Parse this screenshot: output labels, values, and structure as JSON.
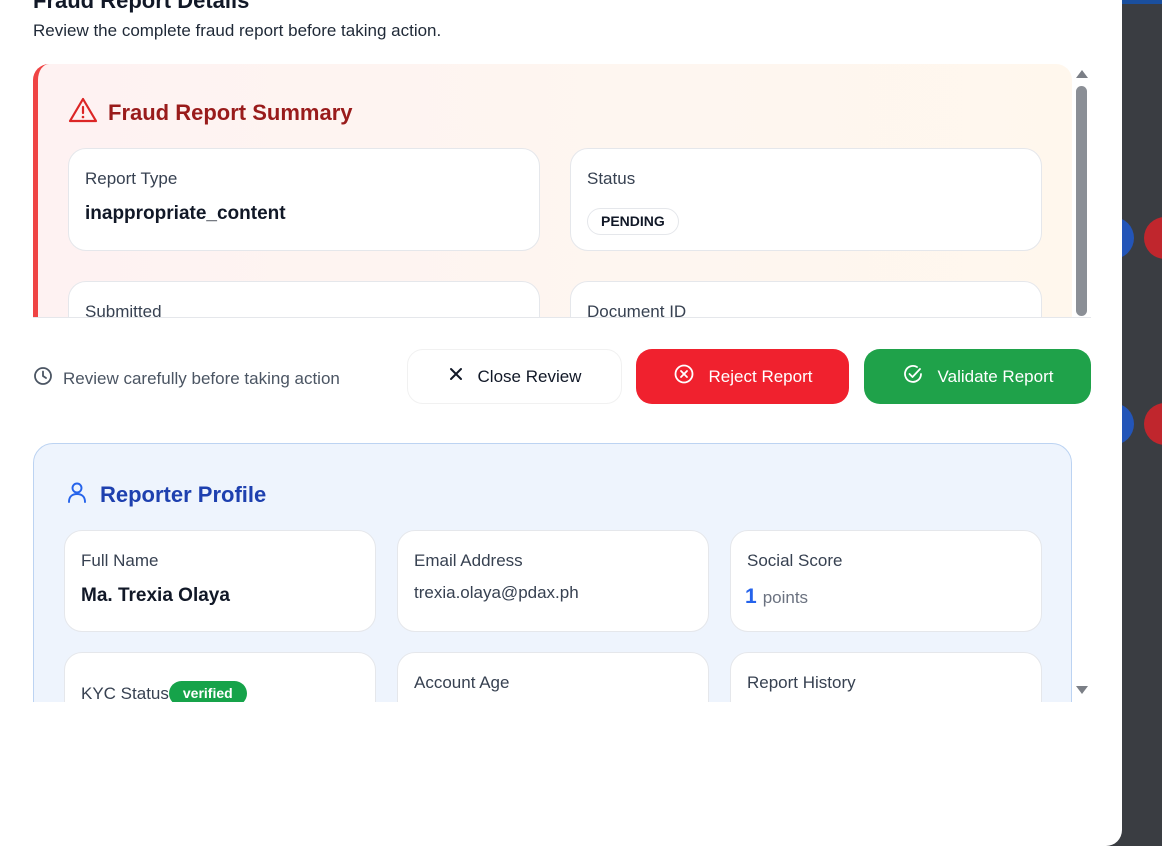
{
  "modal": {
    "title": "Fraud Report Details",
    "subtitle": "Review the complete fraud report before taking action."
  },
  "summary": {
    "title": "Fraud Report Summary",
    "report_type_label": "Report Type",
    "report_type_value": "inappropriate_content",
    "status_label": "Status",
    "status_value": "PENDING",
    "submitted_label": "Submitted",
    "document_id_label": "Document ID"
  },
  "actions": {
    "hint": "Review carefully before taking action",
    "close_label": "Close Review",
    "reject_label": "Reject Report",
    "validate_label": "Validate Report"
  },
  "reporter": {
    "title": "Reporter Profile",
    "full_name_label": "Full Name",
    "full_name_value": "Ma. Trexia Olaya",
    "email_label": "Email Address",
    "email_value": "trexia.olaya@pdax.ph",
    "social_score_label": "Social Score",
    "social_score_value": "1",
    "social_score_unit": "points",
    "kyc_label": "KYC Status",
    "kyc_value": "verified",
    "account_age_label": "Account Age",
    "report_history_label": "Report History"
  },
  "colors": {
    "reject": "#f0212e",
    "validate": "#1fa24a",
    "summary_accent": "#ef4444",
    "reporter_accent": "#1e40af"
  },
  "icons": {
    "summary": "warning-triangle-icon",
    "hint": "clock-icon",
    "close": "x-icon",
    "reject": "x-circle-icon",
    "validate": "check-circle-icon",
    "reporter": "user-icon"
  }
}
